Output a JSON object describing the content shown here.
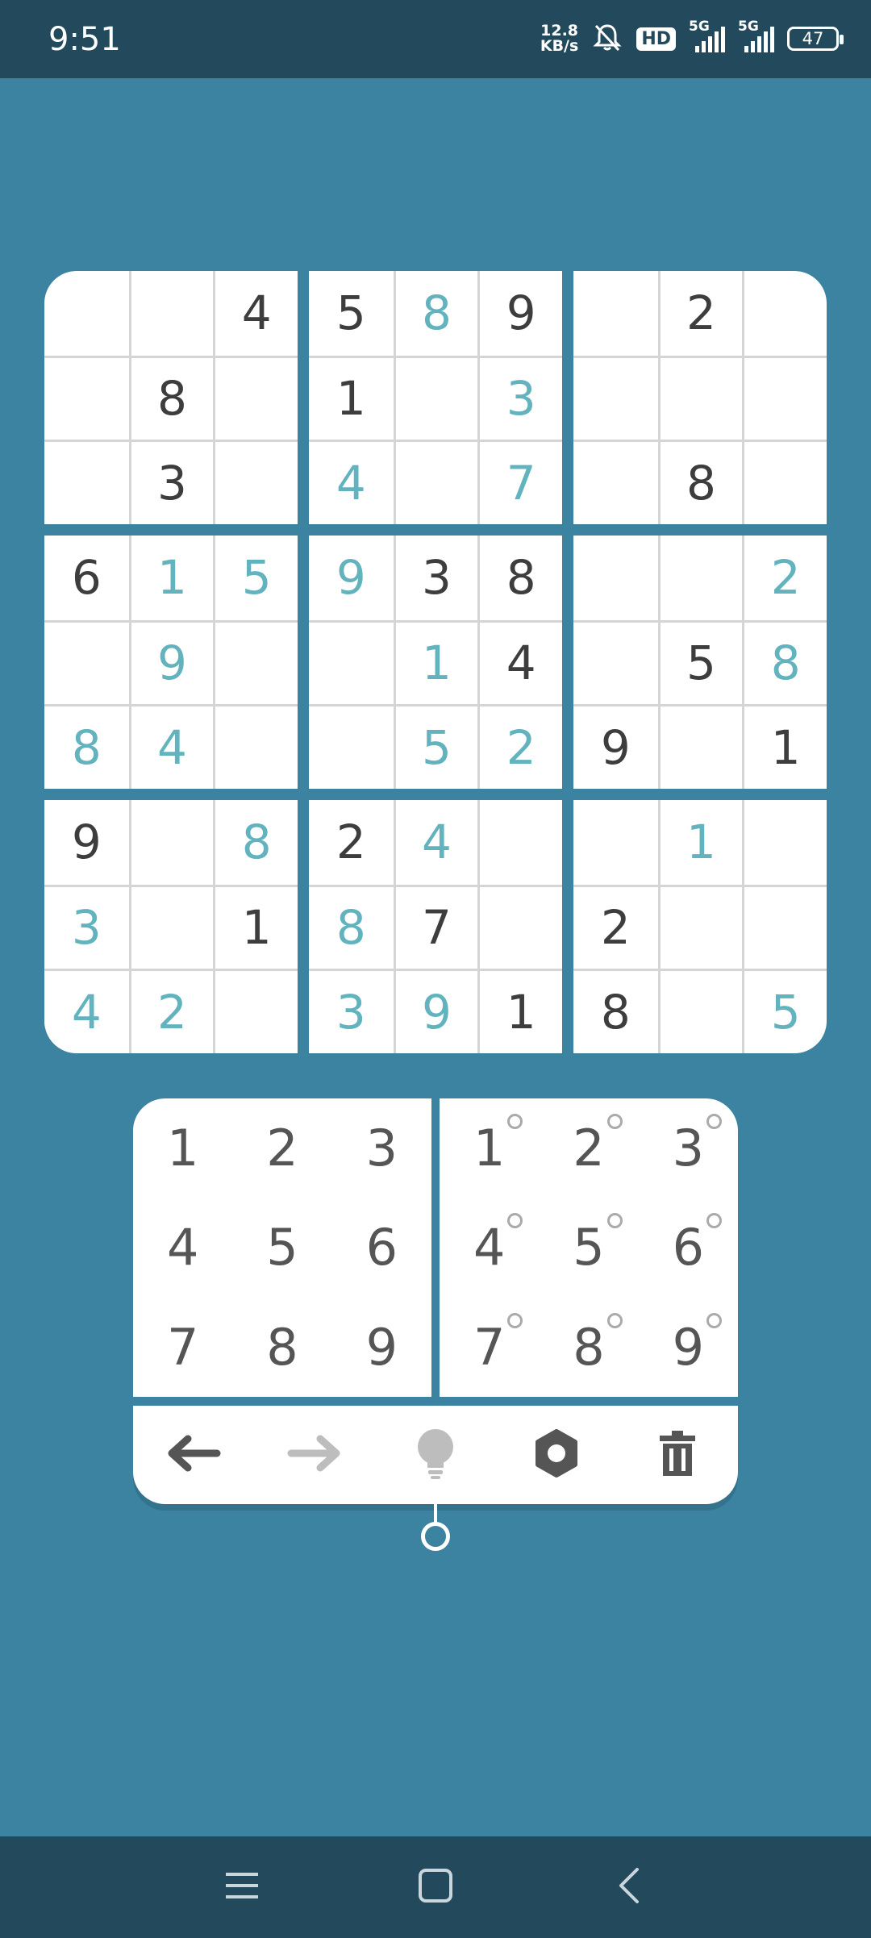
{
  "status_bar": {
    "time": "9:51",
    "net_speed_value": "12.8",
    "net_speed_unit": "KB/s",
    "hd_label": "HD",
    "sim1_label": "5G",
    "sim2_label": "5G",
    "battery": "47"
  },
  "board": [
    [
      [
        "",
        "u"
      ],
      [
        "",
        "u"
      ],
      [
        "4",
        "g"
      ],
      [
        "5",
        "g"
      ],
      [
        "8",
        "u"
      ],
      [
        "9",
        "g"
      ],
      [
        "",
        "u"
      ],
      [
        "2",
        "g"
      ],
      [
        "",
        "u"
      ]
    ],
    [
      [
        "",
        "u"
      ],
      [
        "8",
        "g"
      ],
      [
        "",
        "u"
      ],
      [
        "1",
        "g"
      ],
      [
        "",
        "u"
      ],
      [
        "3",
        "u"
      ],
      [
        "",
        "u"
      ],
      [
        "",
        "u"
      ],
      [
        "",
        "u"
      ]
    ],
    [
      [
        "",
        "u"
      ],
      [
        "3",
        "g"
      ],
      [
        "",
        "u"
      ],
      [
        "4",
        "u"
      ],
      [
        "",
        "u"
      ],
      [
        "7",
        "u"
      ],
      [
        "",
        "u"
      ],
      [
        "8",
        "g"
      ],
      [
        "",
        "u"
      ]
    ],
    [
      [
        "6",
        "g"
      ],
      [
        "1",
        "u"
      ],
      [
        "5",
        "u"
      ],
      [
        "9",
        "u"
      ],
      [
        "3",
        "g"
      ],
      [
        "8",
        "g"
      ],
      [
        "",
        "u"
      ],
      [
        "",
        "u"
      ],
      [
        "2",
        "u"
      ]
    ],
    [
      [
        "",
        "u"
      ],
      [
        "9",
        "u"
      ],
      [
        "",
        "u"
      ],
      [
        "",
        "u"
      ],
      [
        "1",
        "u"
      ],
      [
        "4",
        "g"
      ],
      [
        "",
        "u"
      ],
      [
        "5",
        "g"
      ],
      [
        "8",
        "u"
      ]
    ],
    [
      [
        "8",
        "u"
      ],
      [
        "4",
        "u"
      ],
      [
        "",
        "u"
      ],
      [
        "",
        "u"
      ],
      [
        "5",
        "u"
      ],
      [
        "2",
        "u"
      ],
      [
        "9",
        "g"
      ],
      [
        "",
        "u"
      ],
      [
        "1",
        "g"
      ]
    ],
    [
      [
        "9",
        "g"
      ],
      [
        "",
        "u"
      ],
      [
        "8",
        "u"
      ],
      [
        "2",
        "g"
      ],
      [
        "4",
        "u"
      ],
      [
        "",
        "u"
      ],
      [
        "",
        "u"
      ],
      [
        "1",
        "u"
      ],
      [
        "",
        "u"
      ]
    ],
    [
      [
        "3",
        "u"
      ],
      [
        "",
        "u"
      ],
      [
        "1",
        "g"
      ],
      [
        "8",
        "u"
      ],
      [
        "7",
        "g"
      ],
      [
        "",
        "u"
      ],
      [
        "2",
        "g"
      ],
      [
        "",
        "u"
      ],
      [
        "",
        "u"
      ]
    ],
    [
      [
        "4",
        "u"
      ],
      [
        "2",
        "u"
      ],
      [
        "",
        "u"
      ],
      [
        "3",
        "u"
      ],
      [
        "9",
        "u"
      ],
      [
        "1",
        "g"
      ],
      [
        "8",
        "g"
      ],
      [
        "",
        "u"
      ],
      [
        "5",
        "u"
      ]
    ]
  ],
  "number_pad": [
    "1",
    "2",
    "3",
    "4",
    "5",
    "6",
    "7",
    "8",
    "9"
  ],
  "notes_pad": [
    "1",
    "2",
    "3",
    "4",
    "5",
    "6",
    "7",
    "8",
    "9"
  ],
  "toolbar": {
    "undo_icon": "arrow-left-icon",
    "redo_icon": "arrow-right-icon",
    "hint_icon": "lightbulb-icon",
    "settings_icon": "gear-icon",
    "delete_icon": "trash-icon"
  },
  "colors": {
    "background": "#3c83a1",
    "bars": "#234a5c",
    "given_digit": "#3d3d3d",
    "user_digit": "#63b3bf",
    "disabled_icon": "#bdbdbd"
  }
}
